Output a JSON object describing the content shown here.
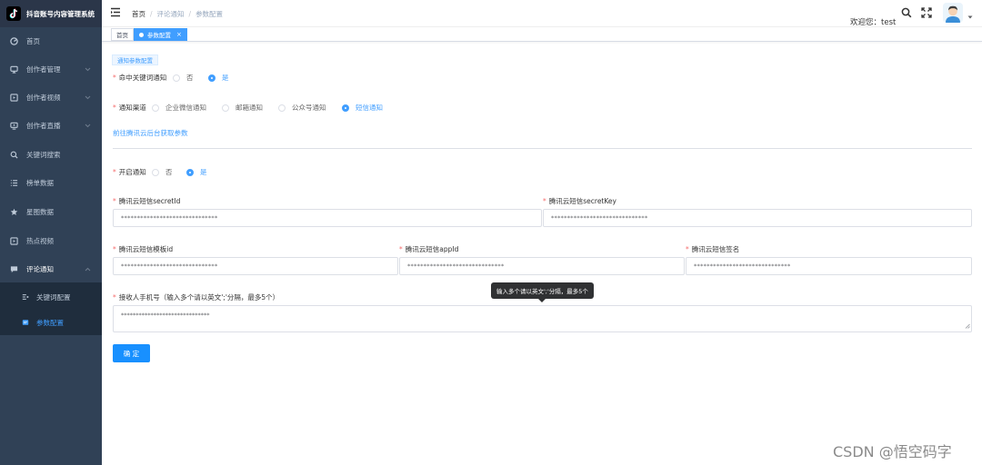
{
  "app": {
    "title": "抖音账号内容管理系统"
  },
  "sidebar": {
    "items": [
      {
        "label": "首页",
        "icon": "dashboard-icon"
      },
      {
        "label": "创作者管理",
        "icon": "monitor-icon"
      },
      {
        "label": "创作者视频",
        "icon": "video-icon"
      },
      {
        "label": "创作者直播",
        "icon": "live-icon"
      },
      {
        "label": "关键词搜索",
        "icon": "search-icon"
      },
      {
        "label": "榜单数据",
        "icon": "list-icon"
      },
      {
        "label": "星图数据",
        "icon": "star-icon"
      },
      {
        "label": "热点视频",
        "icon": "video-icon"
      },
      {
        "label": "评论通知",
        "icon": "message-icon"
      }
    ],
    "subitems": [
      {
        "label": "关键词配置",
        "icon": "keyword-icon"
      },
      {
        "label": "参数配置",
        "icon": "config-icon"
      }
    ]
  },
  "header": {
    "breadcrumb": [
      "首页",
      "评论通知",
      "参数配置"
    ],
    "welcome": "欢迎您：test"
  },
  "tags": {
    "home": "首页",
    "active": "参数配置",
    "close": "×"
  },
  "form": {
    "section_title": "通知参数配置",
    "keyword_notify": {
      "label": "命中关键词通知",
      "options": [
        "否",
        "是"
      ],
      "selected": "是"
    },
    "channel": {
      "label": "通知渠道",
      "options": [
        "企业微信通知",
        "邮箱通知",
        "公众号通知",
        "短信通知"
      ],
      "selected": "短信通知"
    },
    "tencent_link": "前往腾讯云后台获取参数",
    "enable_notify": {
      "label": "开启通知",
      "options": [
        "否",
        "是"
      ],
      "selected": "是"
    },
    "secret_id": {
      "label": "腾讯云短信secretId",
      "value": "******************************"
    },
    "secret_key": {
      "label": "腾讯云短信secretKey",
      "value": "******************************"
    },
    "template_id": {
      "label": "腾讯云短信模板id",
      "value": "******************************"
    },
    "app_id": {
      "label": "腾讯云短信appId",
      "value": "******************************"
    },
    "sign_name": {
      "label": "腾讯云短信签名",
      "value": "******************************"
    },
    "phones": {
      "label": "接收人手机号（输入多个请以英文';'分隔，最多5个）",
      "value": "******************************"
    },
    "tooltip": "输入多个请以英文';'分隔，最多5个",
    "submit": "确 定"
  },
  "watermark": "CSDN @悟空码字",
  "colors": {
    "sidebar": "#304156",
    "primary": "#409eff",
    "button": "#1890ff",
    "required": "#f56c6c"
  }
}
